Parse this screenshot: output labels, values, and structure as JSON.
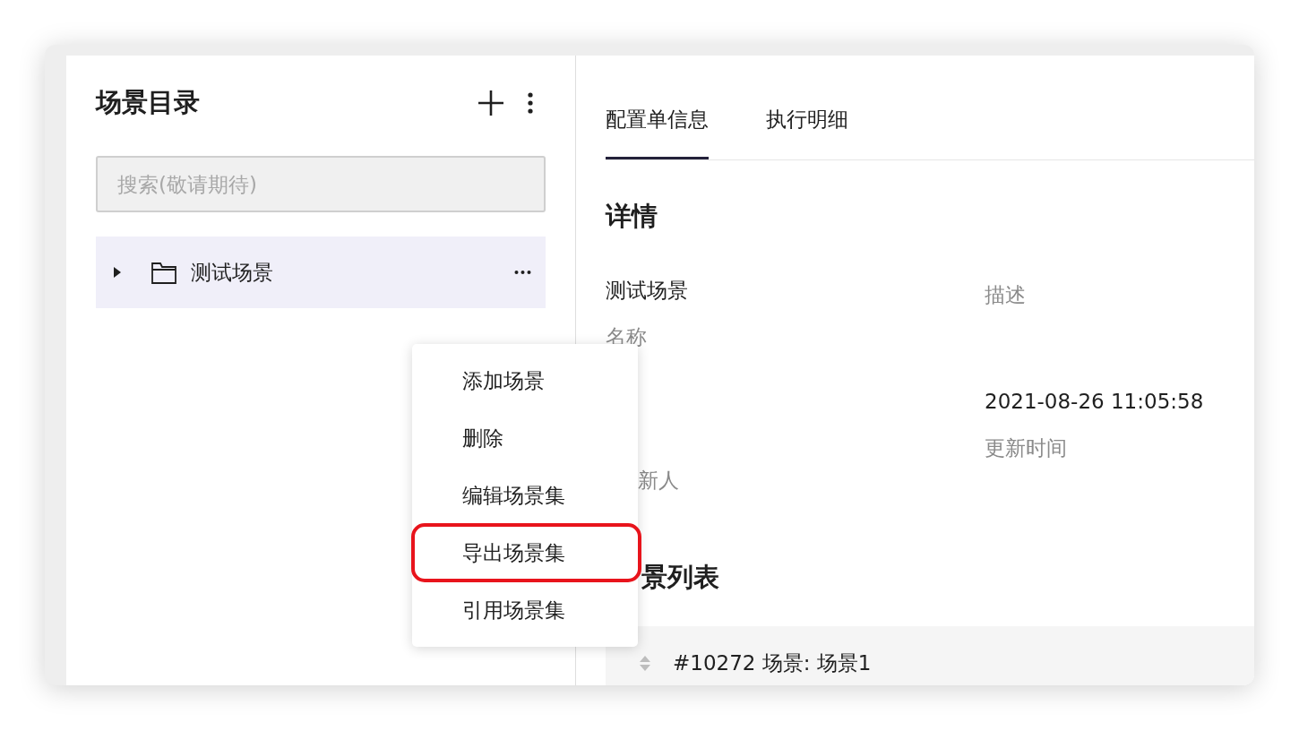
{
  "sidebar": {
    "title": "场景目录",
    "search": {
      "placeholder": "搜索(敬请期待)"
    },
    "tree": [
      {
        "label": "测试场景",
        "expanded": false,
        "selected": true
      }
    ]
  },
  "context_menu": {
    "items": [
      {
        "label": "添加场景",
        "highlighted": false
      },
      {
        "label": "删除",
        "highlighted": false
      },
      {
        "label": "编辑场景集",
        "highlighted": false
      },
      {
        "label": "导出场景集",
        "highlighted": true
      },
      {
        "label": "引用场景集",
        "highlighted": false
      }
    ]
  },
  "tabs": [
    {
      "label": "配置单信息",
      "selected": true
    },
    {
      "label": "执行明细",
      "selected": false
    }
  ],
  "details": {
    "title": "详情",
    "fields": [
      {
        "value": "测试场景",
        "label": "名称"
      },
      {
        "label": "描述"
      },
      {
        "label": "新人",
        "partial": true
      },
      {
        "value": "2021-08-26 11:05:58",
        "label": "更新时间"
      }
    ]
  },
  "scene_list": {
    "title": "景列表",
    "rows": [
      {
        "text": "#10272 场景: 场景1"
      }
    ]
  }
}
